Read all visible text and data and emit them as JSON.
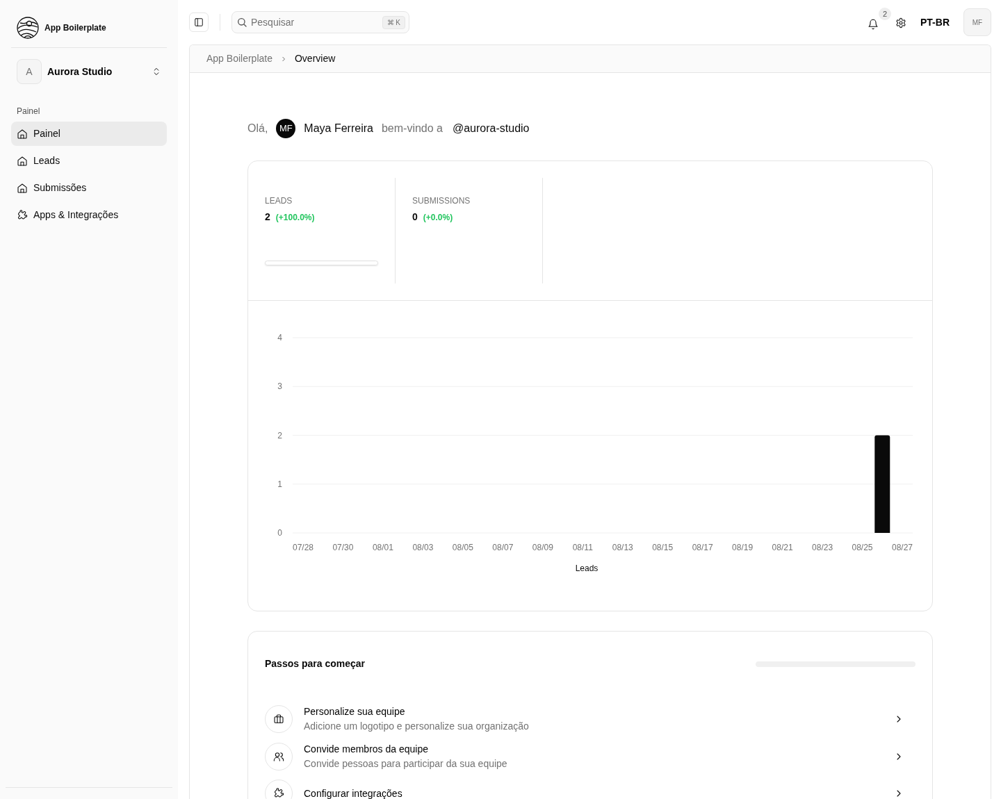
{
  "sidebar": {
    "app_name": "App Boilerplate",
    "team": {
      "initial": "A",
      "name": "Aurora Studio"
    },
    "section_label": "Painel",
    "items": [
      {
        "label": "Painel",
        "selected": true
      },
      {
        "label": "Leads",
        "selected": false
      },
      {
        "label": "Submissões",
        "selected": false
      },
      {
        "label": "Apps & Integrações",
        "selected": false
      }
    ]
  },
  "topbar": {
    "search": {
      "placeholder": "Pesquisar",
      "shortcut": "⌘ K"
    },
    "notifications": "2",
    "language": "PT-BR",
    "avatar": "MF"
  },
  "breadcrumb": [
    {
      "label": "App Boilerplate",
      "current": false
    },
    {
      "label": "Overview",
      "current": true
    }
  ],
  "greeting": {
    "hello": "Olá,",
    "avatar": "MF",
    "name": "Maya Ferreira",
    "welcome": "bem-vindo a",
    "handle": "@aurora-studio"
  },
  "stats": [
    {
      "label": "LEADS",
      "value": "2",
      "change": "(+100.0%)",
      "has_bar": true
    },
    {
      "label": "SUBMISSIONS",
      "value": "0",
      "change": "(+0.0%)",
      "has_bar": false
    }
  ],
  "chart": {
    "chart_data": {
      "type": "bar",
      "categories": [
        "07/28",
        null,
        "07/30",
        null,
        "08/01",
        null,
        "08/03",
        null,
        "08/05",
        null,
        "08/07",
        null,
        "08/09",
        null,
        "08/11",
        null,
        "08/13",
        null,
        "08/15",
        null,
        "08/17",
        null,
        "08/19",
        null,
        "08/21",
        null,
        "08/23",
        null,
        "08/25",
        null,
        "08/27"
      ],
      "series": [
        {
          "name": "Leads",
          "color": "#0a0a0a",
          "values": [
            0,
            0,
            0,
            0,
            0,
            0,
            0,
            0,
            0,
            0,
            0,
            0,
            0,
            0,
            0,
            0,
            0,
            0,
            0,
            0,
            0,
            0,
            0,
            0,
            0,
            0,
            0,
            0,
            0,
            2,
            0
          ]
        }
      ],
      "ylim": [
        0,
        4
      ],
      "yticks": [
        0,
        1,
        2,
        3,
        4
      ],
      "grid": true
    }
  },
  "steps": {
    "title": "Passos para começar",
    "items": [
      {
        "title": "Personalize sua equipe",
        "description": "Adicione um logotipo e personalize sua organização"
      },
      {
        "title": "Convide membros da equipe",
        "description": "Convide pessoas para participar da sua equipe"
      },
      {
        "title": "Configurar integrações"
      }
    ]
  }
}
